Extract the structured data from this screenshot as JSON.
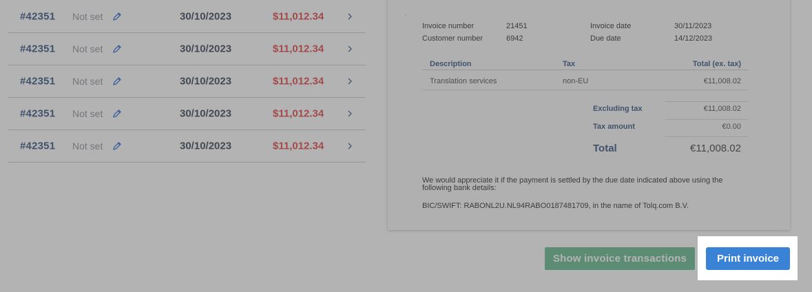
{
  "invoice_list": {
    "rows": [
      {
        "id": "#42351",
        "status": "Not set",
        "date": "30/10/2023",
        "amount": "$11,012.34"
      },
      {
        "id": "#42351",
        "status": "Not set",
        "date": "30/10/2023",
        "amount": "$11,012.34"
      },
      {
        "id": "#42351",
        "status": "Not set",
        "date": "30/10/2023",
        "amount": "$11,012.34"
      },
      {
        "id": "#42351",
        "status": "Not set",
        "date": "30/10/2023",
        "amount": "$11,012.34"
      },
      {
        "id": "#42351",
        "status": "Not set",
        "date": "30/10/2023",
        "amount": "$11,012.34"
      }
    ],
    "edit_icon": "pencil-icon",
    "row_icon": "chevron-right-icon"
  },
  "invoice": {
    "dot": "·",
    "invoice_number_label": "Invoice number",
    "invoice_number": "21451",
    "customer_number_label": "Customer number",
    "customer_number": "6942",
    "invoice_date_label": "Invoice date",
    "invoice_date": "30/11/2023",
    "due_date_label": "Due date",
    "due_date": "14/12/2023",
    "table": {
      "headers": {
        "description": "Description",
        "tax": "Tax",
        "total": "Total (ex. tax)"
      },
      "rows": [
        {
          "description": "Translation services",
          "tax": "non-EU",
          "total": "€11,008.02"
        }
      ]
    },
    "excluding_tax_label": "Excluding tax",
    "excluding_tax": "€11,008.02",
    "tax_amount_label": "Tax amount",
    "tax_amount": "€0.00",
    "total_label": "Total",
    "total": "€11,008.02",
    "payment_note": "We would appreciate it if the payment is settled by the due date indicated above using the following bank details:",
    "bank_details": "BIC/SWIFT: RABONL2U.NL94RABO0187481709, in the name of Tolq.com B.V."
  },
  "actions": {
    "show_transactions_label": "Show invoice transactions",
    "print_label": "Print invoice"
  },
  "colors": {
    "navy": "#2c4d7a",
    "amount_red": "#e03c3c",
    "green_button": "#5fb88a",
    "blue_button": "#3a82d6"
  }
}
